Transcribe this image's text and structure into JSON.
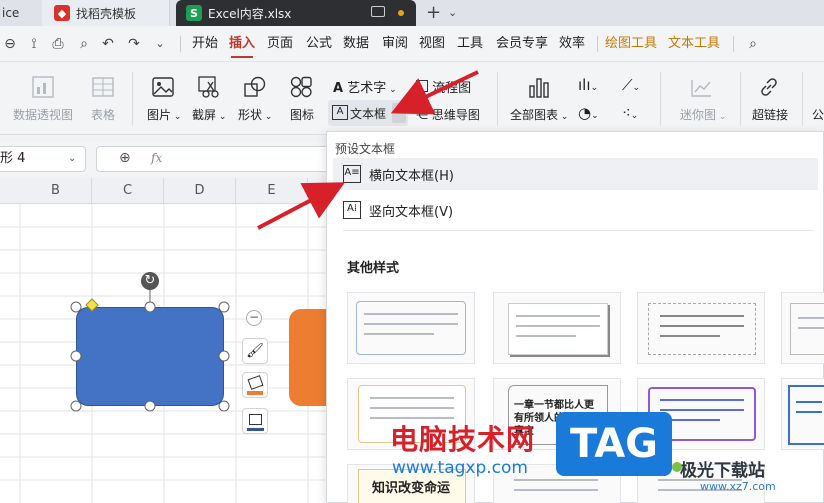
{
  "tabs": [
    {
      "label": "ice",
      "state": "inactive"
    },
    {
      "label": "找稻壳模板",
      "state": "normal",
      "icon_color": "#d9312b",
      "icon_name": "docer-icon"
    },
    {
      "label": "Excel内容.xlsx",
      "state": "active",
      "icon_color": "#1f9d55",
      "icon_letter": "S"
    }
  ],
  "menu": {
    "items": [
      "开始",
      "插入",
      "页面",
      "公式",
      "数据",
      "审阅",
      "视图",
      "工具",
      "会员专享",
      "效率"
    ],
    "active": "插入",
    "context_tabs": [
      "绘图工具",
      "文本工具"
    ]
  },
  "ribbon": {
    "pivot_chart": "数据透视图",
    "table": "表格",
    "picture": "图片",
    "screenshot": "截屏",
    "shape": "形状",
    "icon": "图标",
    "art_text": "艺术字",
    "textbox": "文本框",
    "flowchart": "流程图",
    "mindmap": "思维导图",
    "all_charts": "全部图表",
    "sparkline": "迷你图",
    "hyperlink": "超链接",
    "more": "公"
  },
  "formula_bar": {
    "name_box": "形 4",
    "fx_label": "fx"
  },
  "grid": {
    "columns": [
      "B",
      "C",
      "D",
      "E"
    ]
  },
  "dropdown": {
    "preset_header": "预设文本框",
    "horizontal": "横向文本框(H)",
    "vertical": "竖向文本框(V)",
    "other_header": "其他样式",
    "samples": [
      "一章一节都比人更有所领人的老爹，真宝",
      "知识改变命运"
    ]
  },
  "watermarks": {
    "site_cn": "电脑技术网",
    "site_url": "www.tagxp.com",
    "badge": "TAG",
    "site2": "极光下载站",
    "site2_url": "www.xz7.com"
  },
  "colors": {
    "accent_red": "#c0392b",
    "shape_blue": "#4472c4",
    "shape_orange": "#ed7d31",
    "badge_blue": "#1a7ad9",
    "arrow_red": "#d8202a"
  }
}
